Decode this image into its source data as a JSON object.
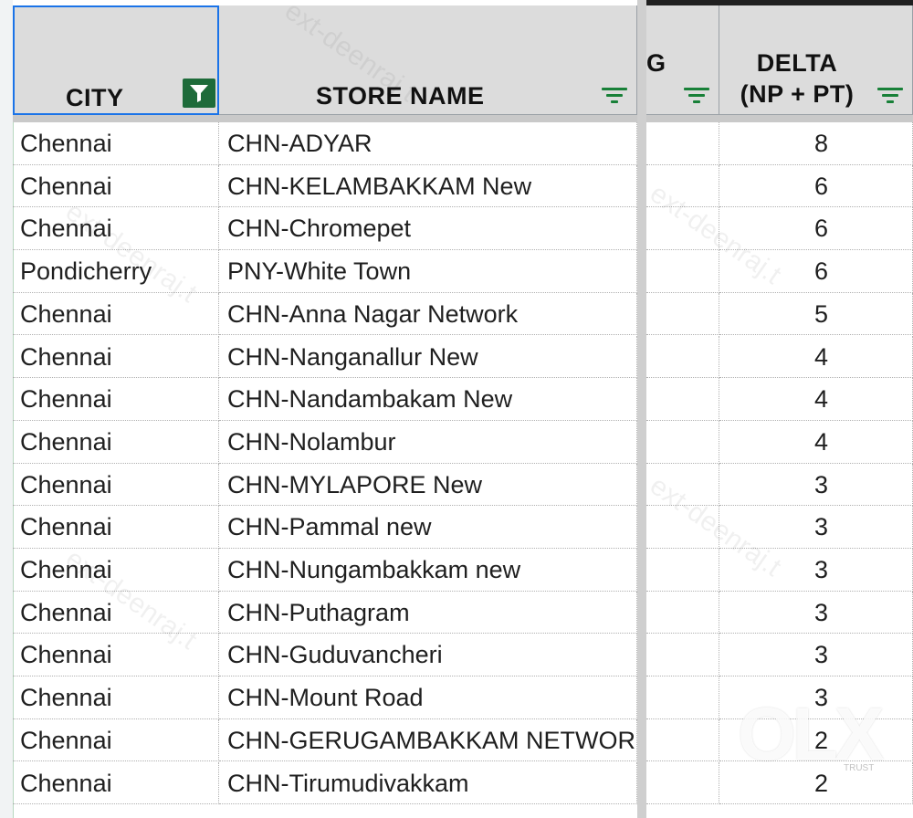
{
  "header": {
    "city_label": "CITY",
    "store_label": "STORE NAME",
    "g_label": "G",
    "delta_line1": "DELTA",
    "delta_line2": "(NP + PT)"
  },
  "rows": [
    {
      "city": "Chennai",
      "store": "CHN-ADYAR",
      "delta": "8"
    },
    {
      "city": "Chennai",
      "store": "CHN-KELAMBAKKAM New",
      "delta": "6"
    },
    {
      "city": "Chennai",
      "store": "CHN-Chromepet",
      "delta": "6"
    },
    {
      "city": "Pondicherry",
      "store": "PNY-White Town",
      "delta": "6"
    },
    {
      "city": "Chennai",
      "store": "CHN-Anna Nagar Network",
      "delta": "5"
    },
    {
      "city": "Chennai",
      "store": "CHN-Nanganallur New",
      "delta": "4"
    },
    {
      "city": "Chennai",
      "store": "CHN-Nandambakam New",
      "delta": "4"
    },
    {
      "city": "Chennai",
      "store": "CHN-Nolambur",
      "delta": "4"
    },
    {
      "city": "Chennai",
      "store": "CHN-MYLAPORE New",
      "delta": "3"
    },
    {
      "city": "Chennai",
      "store": "CHN-Pammal new",
      "delta": "3"
    },
    {
      "city": "Chennai",
      "store": "CHN-Nungambakkam new",
      "delta": "3"
    },
    {
      "city": "Chennai",
      "store": "CHN-Puthagram",
      "delta": "3"
    },
    {
      "city": "Chennai",
      "store": "CHN-Guduvancheri",
      "delta": "3"
    },
    {
      "city": "Chennai",
      "store": "CHN-Mount Road",
      "delta": "3"
    },
    {
      "city": "Chennai",
      "store": "CHN-GERUGAMBAKKAM NETWORK",
      "delta": "2"
    },
    {
      "city": "Chennai",
      "store": "CHN-Tirumudivakkam",
      "delta": "2"
    }
  ],
  "watermark": {
    "logo": "OLX",
    "tag": "TRUST"
  },
  "colors": {
    "filter_active": "#1e6b3a",
    "filter_icon": "#188038",
    "selection": "#1a73e8",
    "header_bg": "#dcdcdc"
  }
}
